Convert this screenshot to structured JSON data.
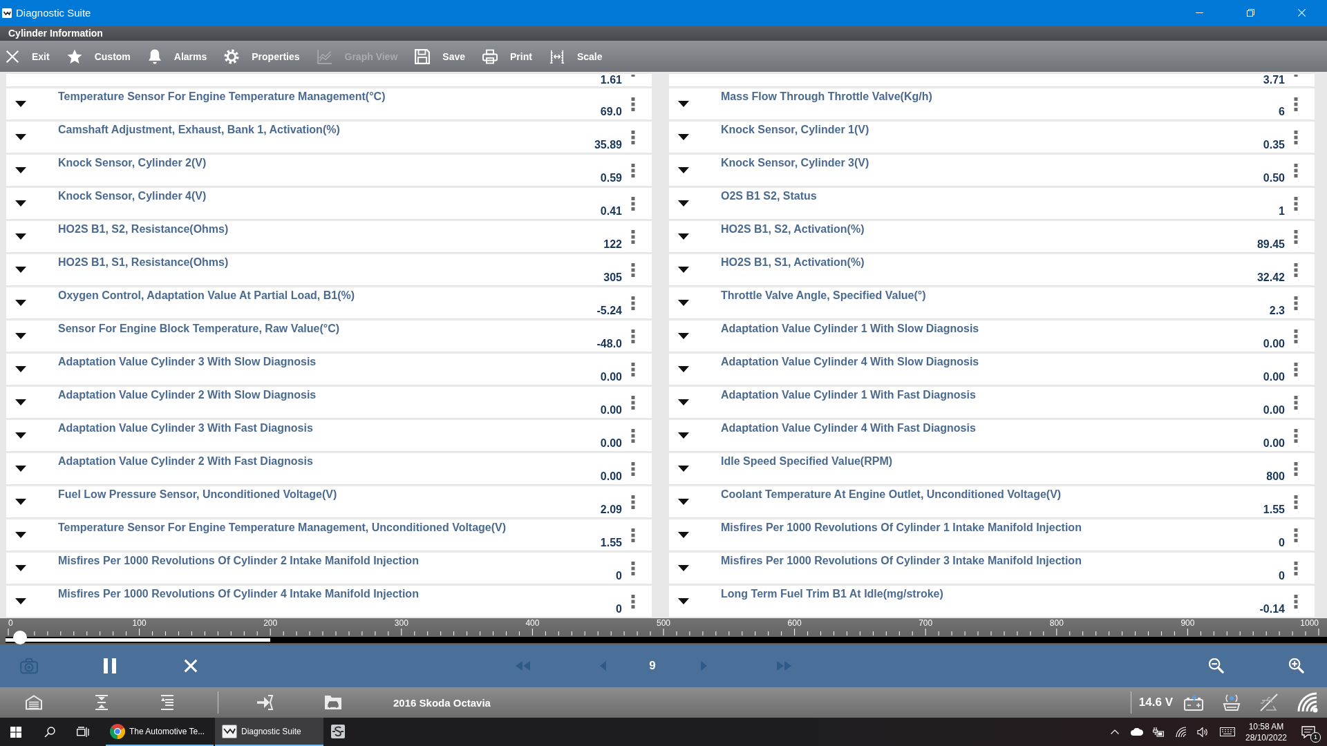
{
  "window": {
    "title": "Diagnostic Suite"
  },
  "header": {
    "title": "Cylinder Information"
  },
  "toolbar": [
    {
      "kind": "exit",
      "label": "Exit",
      "disabled": false
    },
    {
      "kind": "custom",
      "label": "Custom",
      "disabled": false
    },
    {
      "kind": "alarms",
      "label": "Alarms",
      "disabled": false
    },
    {
      "kind": "properties",
      "label": "Properties",
      "disabled": false
    },
    {
      "kind": "graph",
      "label": "Graph View",
      "disabled": true
    },
    {
      "kind": "save",
      "label": "Save",
      "disabled": false
    },
    {
      "kind": "print",
      "label": "Print",
      "disabled": false
    },
    {
      "kind": "scale",
      "label": "Scale",
      "disabled": false
    }
  ],
  "parameters": {
    "columns": [
      {
        "partial_value": "1.61",
        "rows": [
          {
            "name": "Temperature Sensor For Engine Temperature Management(°C)",
            "value": "69.0"
          },
          {
            "name": "Camshaft Adjustment, Exhaust, Bank 1, Activation(%)",
            "value": "35.89"
          },
          {
            "name": "Knock Sensor, Cylinder 2(V)",
            "value": "0.59"
          },
          {
            "name": "Knock Sensor, Cylinder 4(V)",
            "value": "0.41"
          },
          {
            "name": "HO2S B1, S2, Resistance(Ohms)",
            "value": "122"
          },
          {
            "name": "HO2S B1, S1, Resistance(Ohms)",
            "value": "305"
          },
          {
            "name": "Oxygen Control, Adaptation Value At Partial Load, B1(%)",
            "value": "-5.24"
          },
          {
            "name": "Sensor For Engine Block Temperature, Raw Value(°C)",
            "value": "-48.0"
          },
          {
            "name": "Adaptation Value Cylinder 3 With Slow Diagnosis",
            "value": "0.00"
          },
          {
            "name": "Adaptation Value Cylinder 2 With Slow Diagnosis",
            "value": "0.00"
          },
          {
            "name": "Adaptation Value Cylinder 3 With Fast Diagnosis",
            "value": "0.00"
          },
          {
            "name": "Adaptation Value Cylinder 2 With Fast Diagnosis",
            "value": "0.00"
          },
          {
            "name": "Fuel Low Pressure Sensor, Unconditioned Voltage(V)",
            "value": "2.09"
          },
          {
            "name": "Temperature Sensor For Engine Temperature Management, Unconditioned Voltage(V)",
            "value": "1.55"
          },
          {
            "name": "Misfires Per 1000 Revolutions Of Cylinder 2 Intake Manifold Injection",
            "value": "0"
          },
          {
            "name": "Misfires Per 1000 Revolutions Of Cylinder 4 Intake Manifold Injection",
            "value": "0"
          }
        ]
      },
      {
        "partial_value": "3.71",
        "rows": [
          {
            "name": "Mass Flow Through Throttle Valve(Kg/h)",
            "value": "6"
          },
          {
            "name": "Knock Sensor, Cylinder 1(V)",
            "value": "0.35"
          },
          {
            "name": "Knock Sensor, Cylinder 3(V)",
            "value": "0.50"
          },
          {
            "name": "O2S B1 S2, Status",
            "value": "1"
          },
          {
            "name": "HO2S B1, S2, Activation(%)",
            "value": "89.45"
          },
          {
            "name": "HO2S B1, S1, Activation(%)",
            "value": "32.42"
          },
          {
            "name": "Throttle Valve Angle, Specified Value(°)",
            "value": "2.3"
          },
          {
            "name": "Adaptation Value Cylinder 1 With Slow Diagnosis",
            "value": "0.00"
          },
          {
            "name": "Adaptation Value Cylinder 4 With Slow Diagnosis",
            "value": "0.00"
          },
          {
            "name": "Adaptation Value Cylinder 1 With Fast Diagnosis",
            "value": "0.00"
          },
          {
            "name": "Adaptation Value Cylinder 4 With Fast Diagnosis",
            "value": "0.00"
          },
          {
            "name": "Idle Speed Specified Value(RPM)",
            "value": "800"
          },
          {
            "name": "Coolant Temperature At Engine Outlet, Unconditioned Voltage(V)",
            "value": "1.55"
          },
          {
            "name": "Misfires Per 1000 Revolutions Of Cylinder 1 Intake Manifold Injection",
            "value": "0"
          },
          {
            "name": "Misfires Per 1000 Revolutions Of Cylinder 3 Intake Manifold Injection",
            "value": "0"
          },
          {
            "name": "Long Term Fuel Trim B1 At Idle(mg/stroke)",
            "value": "-0.14"
          }
        ]
      }
    ]
  },
  "timeline": {
    "labels": [
      "0",
      "100",
      "200",
      "300",
      "400",
      "500",
      "600",
      "700",
      "800",
      "900",
      "1000"
    ],
    "buffer": {
      "level": 0.2
    },
    "scrubber": {
      "level": 0.009
    }
  },
  "playback": {
    "left": [
      {
        "kind": "camera",
        "disabled": true
      },
      {
        "kind": "pause",
        "disabled": false
      },
      {
        "kind": "stop",
        "disabled": false
      }
    ],
    "center": [
      {
        "kind": "rewind",
        "disabled": true
      },
      {
        "kind": "previous",
        "disabled": true
      },
      {
        "kind": "frame",
        "label": "9"
      },
      {
        "kind": "next",
        "disabled": true
      },
      {
        "kind": "forward",
        "disabled": true
      }
    ],
    "right": [
      {
        "kind": "zoom_out",
        "disabled": false
      },
      {
        "kind": "zoom_in",
        "disabled": false
      }
    ]
  },
  "status_bar": {
    "vehicle": "2016 Skoda Octavia",
    "voltage": "14.6 V"
  },
  "taskbar": {
    "apps": [
      {
        "kind": "browser",
        "label": "The Automotive Te...",
        "selected": false,
        "running": true
      },
      {
        "kind": "diagnostic",
        "label": "Diagnostic Suite",
        "selected": true,
        "running": true
      },
      {
        "kind": "tool",
        "selected": false,
        "running": false
      }
    ],
    "time": "10:58 AM",
    "date": "28/10/2022",
    "notifications": "1"
  }
}
